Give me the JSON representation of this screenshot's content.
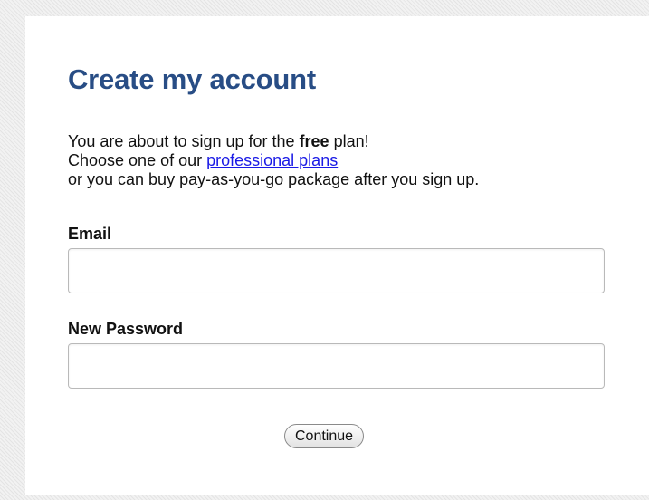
{
  "form": {
    "title": "Create my account",
    "intro": {
      "line1_before": "You are about to sign up for the ",
      "line1_bold": "free",
      "line1_after": " plan!",
      "line2_before": "Choose one of our ",
      "line2_link": "professional plans",
      "line3": "or you can buy pay-as-you-go package after you sign up."
    },
    "email": {
      "label": "Email",
      "value": ""
    },
    "password": {
      "label": "New Password",
      "value": ""
    },
    "continue_label": "Continue"
  },
  "colors": {
    "title": "#284d85",
    "link": "#1a1ae6",
    "page_background": "#ececec"
  }
}
